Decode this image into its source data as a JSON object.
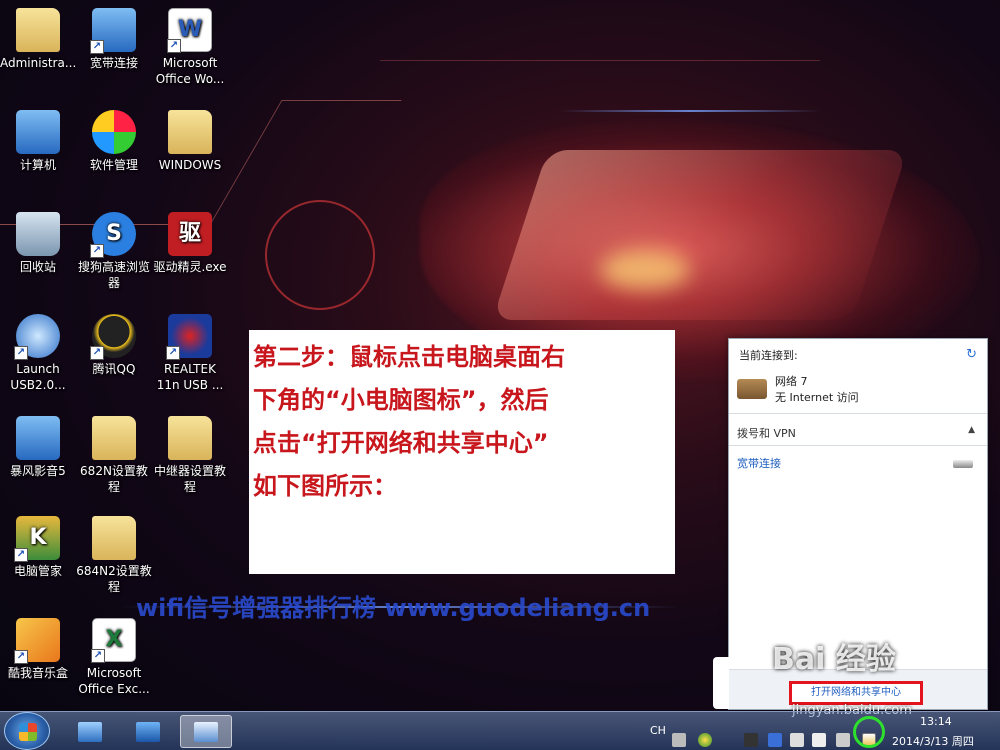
{
  "desktop": {
    "icons": [
      {
        "label_line1": "Administra...",
        "label_line2": "",
        "icon": "user-folder-icon"
      },
      {
        "label_line1": "宽带连接",
        "label_line2": "",
        "icon": "broadband-connection-icon"
      },
      {
        "label_line1": "Microsoft",
        "label_line2": "Office Wo...",
        "icon": "word-icon",
        "glyph": "W"
      },
      {
        "label_line1": "计算机",
        "label_line2": "",
        "icon": "computer-icon"
      },
      {
        "label_line1": "软件管理",
        "label_line2": "",
        "icon": "software-manager-icon"
      },
      {
        "label_line1": "WINDOWS",
        "label_line2": "",
        "icon": "folder-icon"
      },
      {
        "label_line1": "回收站",
        "label_line2": "",
        "icon": "recycle-bin-icon"
      },
      {
        "label_line1": "搜狗高速浏览",
        "label_line2": "器",
        "icon": "sogou-browser-icon",
        "glyph": "S"
      },
      {
        "label_line1": "驱动精灵.exe",
        "label_line2": "",
        "icon": "driver-genius-icon",
        "glyph": "驱"
      },
      {
        "label_line1": "Launch",
        "label_line2": "USB2.0...",
        "icon": "launch-usb-icon"
      },
      {
        "label_line1": "腾讯QQ",
        "label_line2": "",
        "icon": "qq-penguin-icon"
      },
      {
        "label_line1": "REALTEK",
        "label_line2": "11n USB ...",
        "icon": "realtek-wireless-icon"
      },
      {
        "label_line1": "暴风影音5",
        "label_line2": "",
        "icon": "baofeng-player-icon"
      },
      {
        "label_line1": "682N设置教",
        "label_line2": "程",
        "icon": "folder-icon"
      },
      {
        "label_line1": "中继器设置教",
        "label_line2": "程",
        "icon": "folder-icon"
      },
      {
        "label_line1": "电脑管家",
        "label_line2": "",
        "icon": "pc-manager-shield-icon",
        "glyph": "K"
      },
      {
        "label_line1": "684N2设置教",
        "label_line2": "程",
        "icon": "folder-icon"
      },
      {
        "label_line1": "酷我音乐盒",
        "label_line2": "",
        "icon": "kuwo-music-icon"
      },
      {
        "label_line1": "Microsoft",
        "label_line2": "Office Exc...",
        "icon": "excel-icon",
        "glyph": "X"
      }
    ],
    "shortcut_glyph": "↗"
  },
  "overlay": {
    "lines": [
      "第二步：鼠标点击电脑桌面右",
      "下角的“小电脑图标”，然后",
      "点击“打开网络和共享中心”",
      "如下图所示："
    ],
    "watermark": "wifi信号增强器排行榜 www.guodeliang.cn"
  },
  "network_popup": {
    "current_label": "当前连接到:",
    "network_name": "网络  7",
    "network_status": "无 Internet 访问",
    "section_title": "拨号和 VPN",
    "connection_link": "宽带连接",
    "open_center_button": "打开网络和共享中心",
    "refresh_glyph": "↻",
    "caret_glyph": "▲"
  },
  "baidu_watermark": {
    "logo": "Bai 经验",
    "url": "jingyan.baidu.com"
  },
  "taskbar": {
    "lang": "CH",
    "time": "13:14",
    "date": "2014/3/13 周四"
  },
  "colors": {
    "instruction_red": "#c8161d",
    "highlight_red": "#e3141d",
    "highlight_green": "#2ee02e",
    "watermark_blue": "#2a4bcf"
  }
}
